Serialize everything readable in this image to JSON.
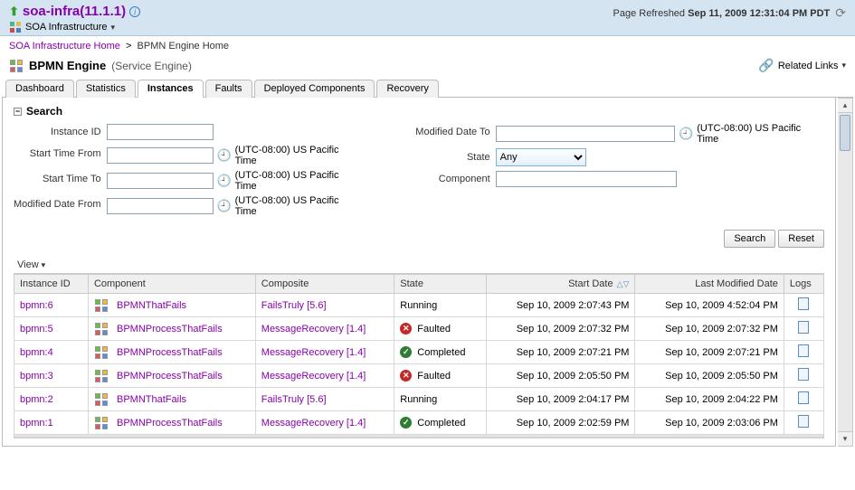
{
  "header": {
    "title": "soa-infra(11.1.1)",
    "subLabel": "SOA Infrastructure",
    "refreshLabel": "Page Refreshed",
    "refreshTime": "Sep 11, 2009 12:31:04 PM PDT"
  },
  "breadcrumb": {
    "home": "SOA Infrastructure Home",
    "current": "BPMN Engine Home"
  },
  "engine": {
    "name": "BPMN Engine",
    "sub": "(Service Engine)",
    "related": "Related Links"
  },
  "tabs": {
    "dashboard": "Dashboard",
    "statistics": "Statistics",
    "instances": "Instances",
    "faults": "Faults",
    "deployed": "Deployed Components",
    "recovery": "Recovery"
  },
  "search": {
    "heading": "Search",
    "labels": {
      "instanceId": "Instance ID",
      "startFrom": "Start Time From",
      "startTo": "Start Time To",
      "modFrom": "Modified Date From",
      "modTo": "Modified Date To",
      "state": "State",
      "component": "Component"
    },
    "tz": "(UTC-08:00) US Pacific Time",
    "stateValue": "Any",
    "buttons": {
      "search": "Search",
      "reset": "Reset"
    }
  },
  "viewLabel": "View",
  "columns": {
    "instanceId": "Instance ID",
    "component": "Component",
    "composite": "Composite",
    "state": "State",
    "startDate": "Start Date",
    "lastMod": "Last Modified Date",
    "logs": "Logs"
  },
  "states": {
    "running": "Running",
    "faulted": "Faulted",
    "completed": "Completed"
  },
  "rows": [
    {
      "id": "bpmn:6",
      "component": "BPMNThatFails",
      "composite": "FailsTruly [5.6]",
      "state": "running",
      "start": "Sep 10, 2009 2:07:43 PM",
      "mod": "Sep 10, 2009 4:52:04 PM"
    },
    {
      "id": "bpmn:5",
      "component": "BPMNProcessThatFails",
      "composite": "MessageRecovery [1.4]",
      "state": "faulted",
      "start": "Sep 10, 2009 2:07:32 PM",
      "mod": "Sep 10, 2009 2:07:32 PM"
    },
    {
      "id": "bpmn:4",
      "component": "BPMNProcessThatFails",
      "composite": "MessageRecovery [1.4]",
      "state": "completed",
      "start": "Sep 10, 2009 2:07:21 PM",
      "mod": "Sep 10, 2009 2:07:21 PM"
    },
    {
      "id": "bpmn:3",
      "component": "BPMNProcessThatFails",
      "composite": "MessageRecovery [1.4]",
      "state": "faulted",
      "start": "Sep 10, 2009 2:05:50 PM",
      "mod": "Sep 10, 2009 2:05:50 PM"
    },
    {
      "id": "bpmn:2",
      "component": "BPMNThatFails",
      "composite": "FailsTruly [5.6]",
      "state": "running",
      "start": "Sep 10, 2009 2:04:17 PM",
      "mod": "Sep 10, 2009 2:04:22 PM"
    },
    {
      "id": "bpmn:1",
      "component": "BPMNProcessThatFails",
      "composite": "MessageRecovery [1.4]",
      "state": "completed",
      "start": "Sep 10, 2009 2:02:59 PM",
      "mod": "Sep 10, 2009 2:03:06 PM"
    }
  ]
}
